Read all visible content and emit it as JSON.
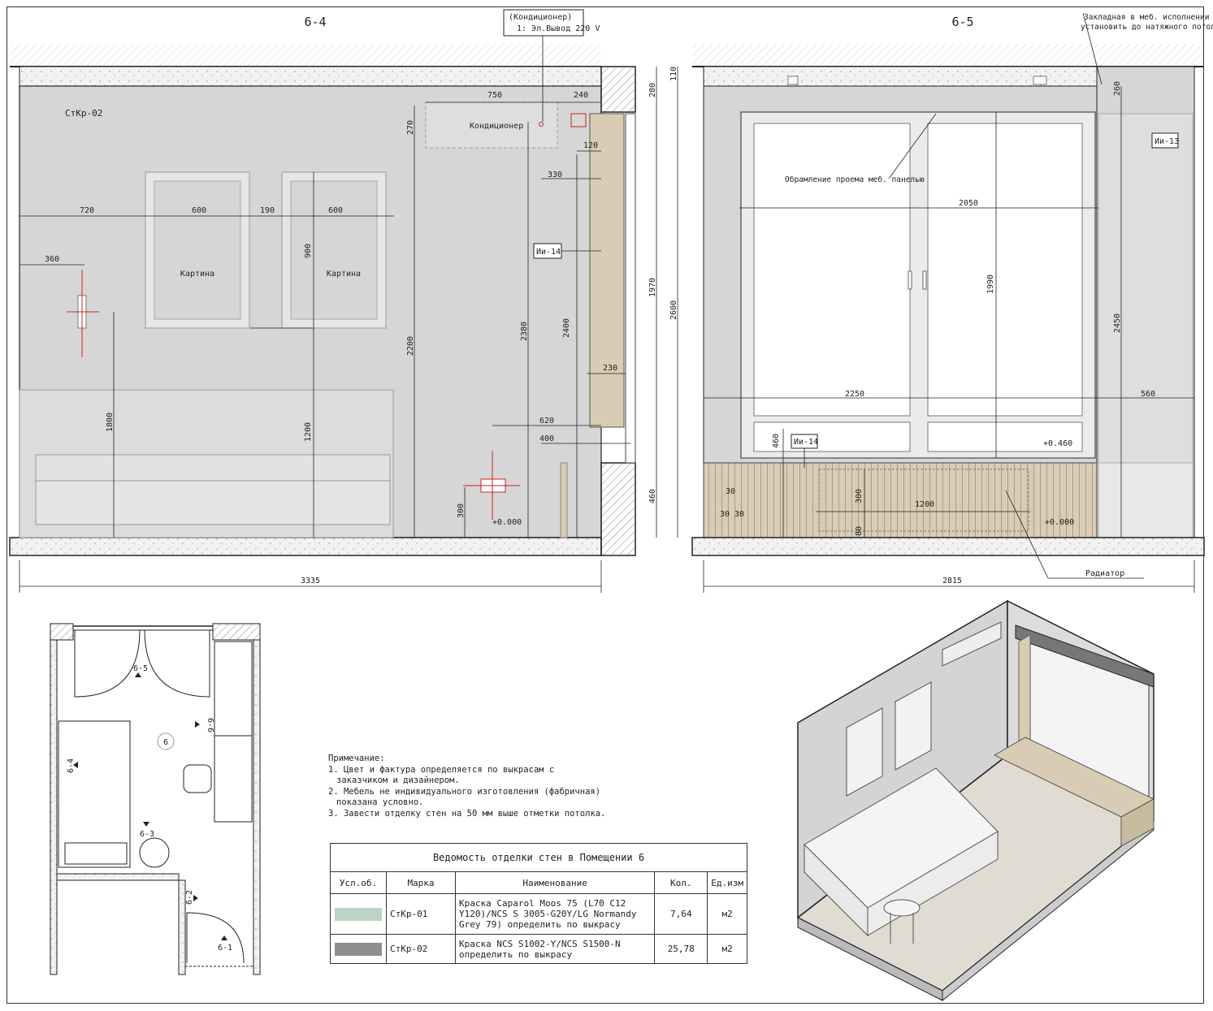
{
  "elevation_left": {
    "title": "6-4",
    "mark": "СтКр-02",
    "ac_callout": {
      "line1": "(Кондиционер)",
      "line2": "1: Эл.Вывод 220 V"
    },
    "ac_label": "Кондиционер",
    "picture_label_1": "Картина",
    "picture_label_2": "Картина",
    "panel_tag": "Ии-14",
    "dims": {
      "d750": "750",
      "d240": "240",
      "d280": "280",
      "d110": "110",
      "d270": "270",
      "d120": "120",
      "d330": "330",
      "d720": "720",
      "d600a": "600",
      "d190": "190",
      "d600b": "600",
      "d900": "900",
      "d360": "360",
      "d1970": "1970",
      "d2600": "2600",
      "d2200": "2200",
      "d2380": "2380",
      "d2400": "2400",
      "d230": "230",
      "d1800": "1800",
      "d1200": "1200",
      "d620": "620",
      "d400": "400",
      "d460": "460",
      "d300": "300",
      "lvl0": "+0.000",
      "total": "3335"
    }
  },
  "elevation_right": {
    "title": "6-5",
    "note_top": {
      "line1": "Закладная в меб. исполнении",
      "line2": "установить до натяжного потолка"
    },
    "frame_label": "Обрамление проема меб. панелью",
    "panel_tag_1": "Ии-13",
    "panel_tag_2": "Ии-14",
    "radiator_label": "Радиатор",
    "dims": {
      "d260": "260",
      "d2050": "2050",
      "d1990": "1990",
      "d2450": "2450",
      "d2250": "2250",
      "d560": "560",
      "d460": "460",
      "lvl460": "+0.460",
      "d30a": "30",
      "d30b": "30",
      "d30c": "30",
      "d300": "300",
      "d1200": "1200",
      "d80": "80",
      "lvl0": "+0.000",
      "total": "2815"
    }
  },
  "plan": {
    "room_number": "6",
    "views": [
      "6-5",
      "6-6",
      "6-4",
      "6-3",
      "6-2",
      "6-1"
    ]
  },
  "notes": {
    "heading": "Примечание:",
    "items": [
      "1. Цвет и фактура определяется по выкрасам с",
      "    заказчиком и дизайнером.",
      "2. Мебель не индивидуального изготовления (фабричная)",
      "    показана условно.",
      "3. Завести отделку стен на 50 мм выше отметки потолка."
    ]
  },
  "finish_table": {
    "caption": "Ведомость отделки стен в Помещении 6",
    "headers": [
      "Усл.об.",
      "Марка",
      "Наименование",
      "Кол.",
      "Ед.изм"
    ],
    "rows": [
      {
        "swatch": "#bcd3c6",
        "mark": "СтКр-01",
        "name": "Краска Caparol Moos 75 (L70 C12 Y120)/NCS S 3005-G20Y/LG Normandy Grey 79) определить по выкрасу",
        "qty": "7,64",
        "unit": "м2"
      },
      {
        "swatch": "#8e8e8e",
        "mark": "СтКр-02",
        "name": "Краска NCS S1002-Y/NCS S1500-N определить по выкрасу",
        "qty": "25,78",
        "unit": "м2"
      }
    ]
  },
  "colors": {
    "wall_fill": "#d6d6d6",
    "line": "#222222",
    "red": "#d02020",
    "wood": "#d8cdb4"
  }
}
